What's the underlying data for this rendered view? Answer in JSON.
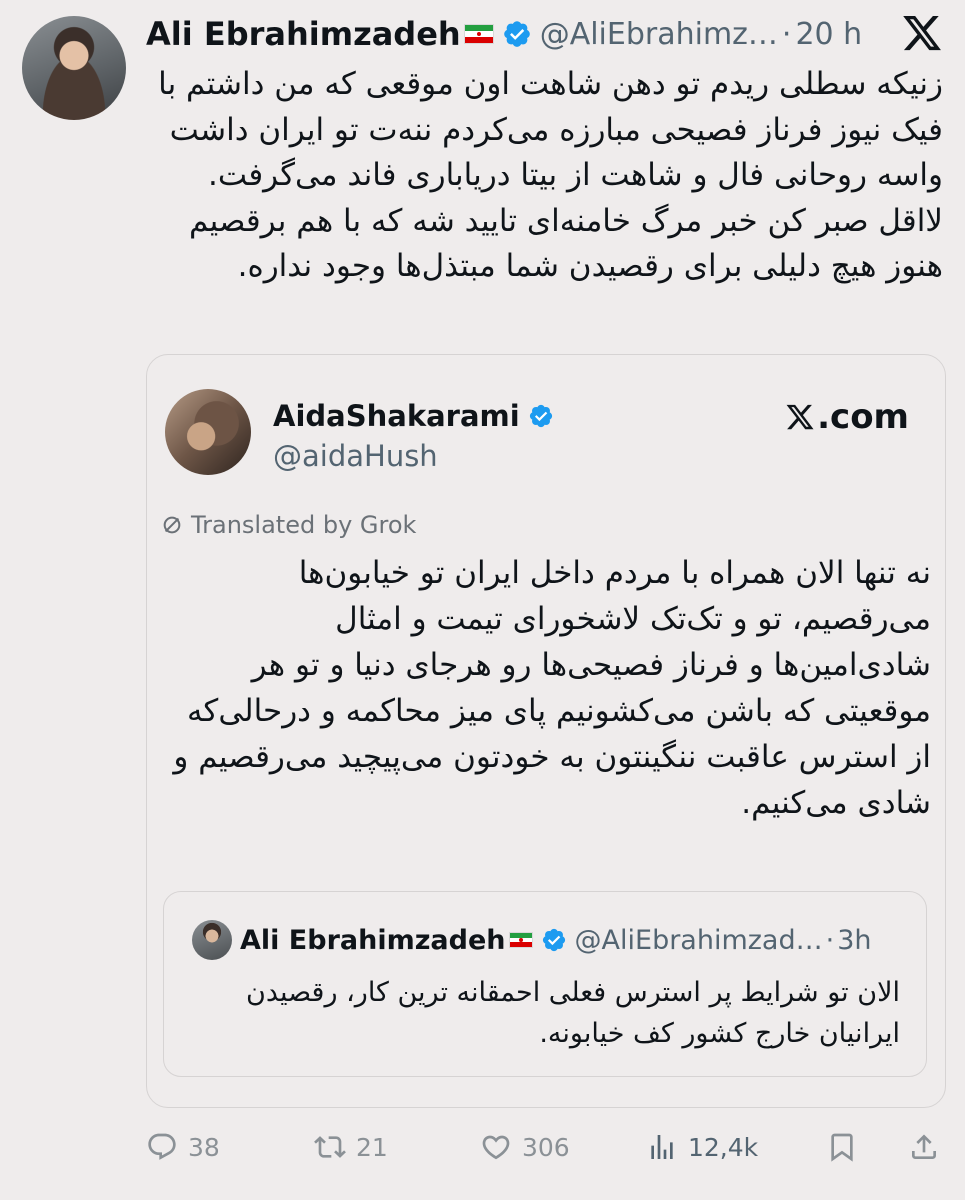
{
  "tweet": {
    "author_name": "Ali Ebrahimzadeh",
    "author_handle": "@AliEbrahimz…",
    "separator": "·",
    "time": "20 h",
    "text": "زنیکه سطلی ریدم تو دهن شاهت اون موقعی که من داشتم با فیک نیوز فرناز فصیحی مبارزه می‌کردم ننه‌ت تو ایران داشت واسه روحانی فال و شاهت از بیتا دریاباری فاند می‌گرفت. لااقل صبر کن خبر مرگ خامنه‌ای تایید شه که با هم برقصیم هنوز هیچ دلیلی برای رقصیدن شما مبتذل‌ها وجود نداره.",
    "icons": {
      "verified": "verified-badge-icon",
      "logo": "x-logo-icon",
      "flag": "iran-flag-icon"
    }
  },
  "quote": {
    "author_name": "AidaShakarami",
    "author_handle": "@aidaHush",
    "source_label": "com",
    "translated_label": "Translated by Grok",
    "text": "نه تنها الان همراه با مردم داخل ایران تو خیابون‌ها می‌رقصیم، تو و تک‌تک لاشخورای تیمت و امثال شادی‌امین‌ها و فرناز فصیحی‌ها رو هرجای دنیا و تو هر موقعیتی که باشن می‌کشونیم پای میز محاکمه و درحالی‌که از استرس عاقبت ننگینتون به خودتون می‌پیچید می‌رقصیم و شادی می‌کنیم.",
    "nested": {
      "author_name": "Ali Ebrahimzadeh",
      "author_handle": "@AliEbrahimzad…",
      "separator": "·",
      "time": "3h",
      "text": "الان تو شرایط پر استرس فعلی احمقانه ترین کار، رقصیدن ایرانیان خارج کشور کف خیابونه."
    }
  },
  "actions": {
    "replies": "38",
    "retweets": "21",
    "likes": "306",
    "views": "12,4k",
    "icons": [
      "reply-icon",
      "retweet-icon",
      "like-icon",
      "views-icon",
      "bookmark-icon",
      "share-icon"
    ]
  },
  "colors": {
    "background": "#efecec",
    "text": "#0f1419",
    "secondary": "#536471",
    "verified": "#1d9bf0"
  }
}
